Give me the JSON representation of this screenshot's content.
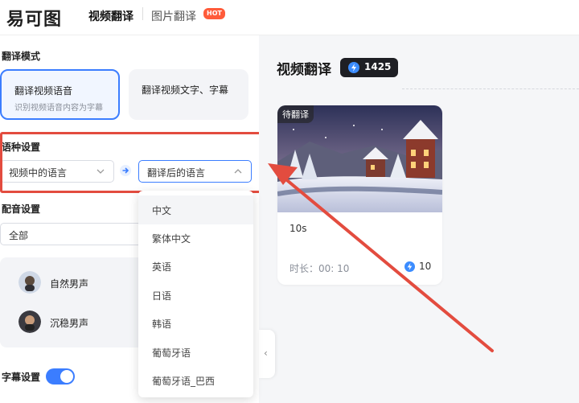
{
  "header": {
    "logo": "易可图",
    "nav": [
      {
        "label": "视频翻译",
        "active": true
      },
      {
        "label": "图片翻译",
        "badge": "HOT"
      }
    ]
  },
  "left": {
    "mode_title": "翻译模式",
    "modes": [
      {
        "title": "翻译视频语音",
        "subtitle": "识别视频语音内容为字幕",
        "active": true
      },
      {
        "title": "翻译视频文字、字幕",
        "subtitle": "",
        "active": false
      }
    ],
    "lang_title": "语种设置",
    "source_lang_placeholder": "视频中的语言",
    "target_lang_placeholder": "翻译后的语言",
    "dub_title": "配音设置",
    "dub_filter": "全部",
    "voices": [
      "自然男声",
      "沉稳男声"
    ],
    "subtitle_title": "字幕设置",
    "subtitle_enabled": true
  },
  "dropdown": {
    "options": [
      "中文",
      "繁体中文",
      "英语",
      "日语",
      "韩语",
      "葡萄牙语",
      "葡萄牙语_巴西"
    ],
    "hovered_index": 0
  },
  "right": {
    "title": "视频翻译",
    "credits": "1425",
    "video": {
      "status_badge": "待翻译",
      "duration_short": "10s",
      "duration_label": "时长：00: 10",
      "cost": "10"
    }
  },
  "colors": {
    "accent": "#3b7dff",
    "annotation": "#e34c3f",
    "hot": "#ff5b3a"
  }
}
